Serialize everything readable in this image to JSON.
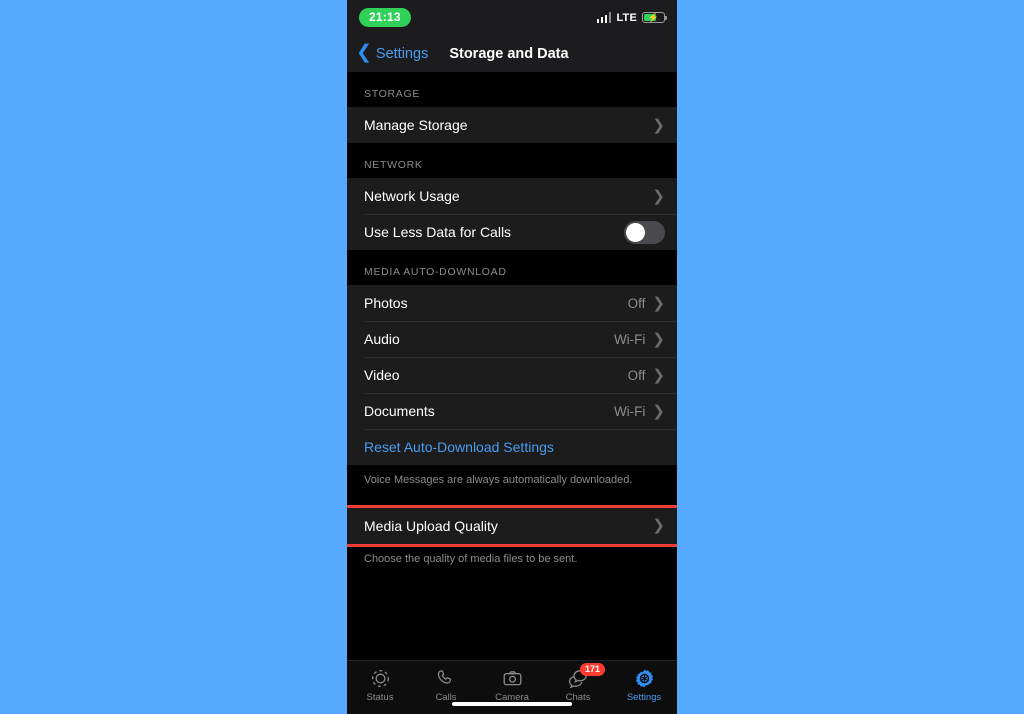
{
  "page": {
    "background_color": "#55aaff",
    "screen_background": "#000000"
  },
  "status_bar": {
    "time": "21:13",
    "time_pill_color": "#30d158",
    "network_label": "LTE",
    "signal_icon": "signal-bars-icon",
    "battery_icon": "battery-charging-icon",
    "battery_color": "#30d158"
  },
  "nav_bar": {
    "back_icon": "chevron-left-icon",
    "back_label": "Settings",
    "title": "Storage and Data",
    "accent_color": "#4a9cf0"
  },
  "sections": [
    {
      "header": "STORAGE",
      "rows": [
        {
          "label": "Manage Storage",
          "value": "",
          "accessory": "chevron-right-icon"
        }
      ],
      "footnote": ""
    },
    {
      "header": "NETWORK",
      "rows": [
        {
          "label": "Network Usage",
          "value": "",
          "accessory": "chevron-right-icon"
        },
        {
          "label": "Use Less Data for Calls",
          "value": "",
          "accessory": "toggle-off"
        }
      ],
      "footnote": ""
    },
    {
      "header": "MEDIA AUTO-DOWNLOAD",
      "rows": [
        {
          "label": "Photos",
          "value": "Off",
          "accessory": "chevron-right-icon"
        },
        {
          "label": "Audio",
          "value": "Wi-Fi",
          "accessory": "chevron-right-icon"
        },
        {
          "label": "Video",
          "value": "Off",
          "accessory": "chevron-right-icon"
        },
        {
          "label": "Documents",
          "value": "Wi-Fi",
          "accessory": "chevron-right-icon"
        },
        {
          "label": "Reset Auto-Download Settings",
          "value": "",
          "accessory": "none"
        }
      ],
      "footnote": "Voice Messages are always automatically downloaded."
    }
  ],
  "highlighted_row": {
    "label": "Media Upload Quality",
    "accessory": "chevron-right-icon",
    "highlight_color": "#ef3b36",
    "footnote": "Choose the quality of media files to be sent."
  },
  "tab_bar": {
    "tabs": [
      {
        "label": "Status",
        "icon": "status-ring-icon",
        "badge": "",
        "active": false
      },
      {
        "label": "Calls",
        "icon": "phone-icon",
        "badge": "",
        "active": false
      },
      {
        "label": "Camera",
        "icon": "camera-icon",
        "badge": "",
        "active": false
      },
      {
        "label": "Chats",
        "icon": "chat-bubbles-icon",
        "badge": "171",
        "active": false
      },
      {
        "label": "Settings",
        "icon": "gear-icon",
        "badge": "",
        "active": true
      }
    ],
    "active_color": "#4a9cf0",
    "badge_color": "#ff3b30"
  }
}
